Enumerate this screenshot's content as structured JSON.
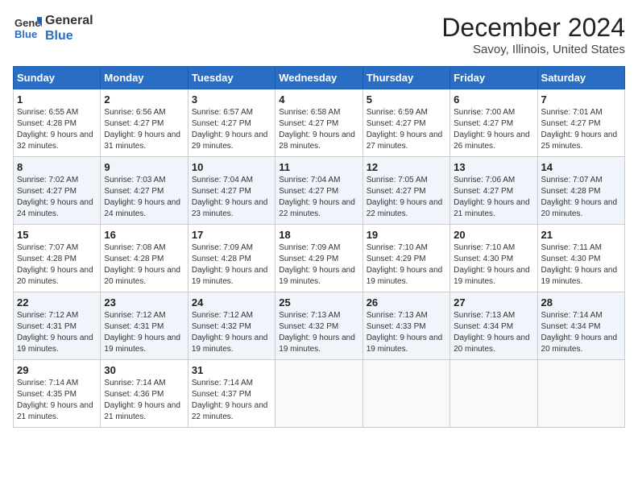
{
  "header": {
    "logo_general": "General",
    "logo_blue": "Blue",
    "month_title": "December 2024",
    "location": "Savoy, Illinois, United States"
  },
  "weekdays": [
    "Sunday",
    "Monday",
    "Tuesday",
    "Wednesday",
    "Thursday",
    "Friday",
    "Saturday"
  ],
  "weeks": [
    [
      {
        "day": "1",
        "sunrise": "6:55 AM",
        "sunset": "4:28 PM",
        "daylight": "9 hours and 32 minutes."
      },
      {
        "day": "2",
        "sunrise": "6:56 AM",
        "sunset": "4:27 PM",
        "daylight": "9 hours and 31 minutes."
      },
      {
        "day": "3",
        "sunrise": "6:57 AM",
        "sunset": "4:27 PM",
        "daylight": "9 hours and 29 minutes."
      },
      {
        "day": "4",
        "sunrise": "6:58 AM",
        "sunset": "4:27 PM",
        "daylight": "9 hours and 28 minutes."
      },
      {
        "day": "5",
        "sunrise": "6:59 AM",
        "sunset": "4:27 PM",
        "daylight": "9 hours and 27 minutes."
      },
      {
        "day": "6",
        "sunrise": "7:00 AM",
        "sunset": "4:27 PM",
        "daylight": "9 hours and 26 minutes."
      },
      {
        "day": "7",
        "sunrise": "7:01 AM",
        "sunset": "4:27 PM",
        "daylight": "9 hours and 25 minutes."
      }
    ],
    [
      {
        "day": "8",
        "sunrise": "7:02 AM",
        "sunset": "4:27 PM",
        "daylight": "9 hours and 24 minutes."
      },
      {
        "day": "9",
        "sunrise": "7:03 AM",
        "sunset": "4:27 PM",
        "daylight": "9 hours and 24 minutes."
      },
      {
        "day": "10",
        "sunrise": "7:04 AM",
        "sunset": "4:27 PM",
        "daylight": "9 hours and 23 minutes."
      },
      {
        "day": "11",
        "sunrise": "7:04 AM",
        "sunset": "4:27 PM",
        "daylight": "9 hours and 22 minutes."
      },
      {
        "day": "12",
        "sunrise": "7:05 AM",
        "sunset": "4:27 PM",
        "daylight": "9 hours and 22 minutes."
      },
      {
        "day": "13",
        "sunrise": "7:06 AM",
        "sunset": "4:27 PM",
        "daylight": "9 hours and 21 minutes."
      },
      {
        "day": "14",
        "sunrise": "7:07 AM",
        "sunset": "4:28 PM",
        "daylight": "9 hours and 20 minutes."
      }
    ],
    [
      {
        "day": "15",
        "sunrise": "7:07 AM",
        "sunset": "4:28 PM",
        "daylight": "9 hours and 20 minutes."
      },
      {
        "day": "16",
        "sunrise": "7:08 AM",
        "sunset": "4:28 PM",
        "daylight": "9 hours and 20 minutes."
      },
      {
        "day": "17",
        "sunrise": "7:09 AM",
        "sunset": "4:28 PM",
        "daylight": "9 hours and 19 minutes."
      },
      {
        "day": "18",
        "sunrise": "7:09 AM",
        "sunset": "4:29 PM",
        "daylight": "9 hours and 19 minutes."
      },
      {
        "day": "19",
        "sunrise": "7:10 AM",
        "sunset": "4:29 PM",
        "daylight": "9 hours and 19 minutes."
      },
      {
        "day": "20",
        "sunrise": "7:10 AM",
        "sunset": "4:30 PM",
        "daylight": "9 hours and 19 minutes."
      },
      {
        "day": "21",
        "sunrise": "7:11 AM",
        "sunset": "4:30 PM",
        "daylight": "9 hours and 19 minutes."
      }
    ],
    [
      {
        "day": "22",
        "sunrise": "7:12 AM",
        "sunset": "4:31 PM",
        "daylight": "9 hours and 19 minutes."
      },
      {
        "day": "23",
        "sunrise": "7:12 AM",
        "sunset": "4:31 PM",
        "daylight": "9 hours and 19 minutes."
      },
      {
        "day": "24",
        "sunrise": "7:12 AM",
        "sunset": "4:32 PM",
        "daylight": "9 hours and 19 minutes."
      },
      {
        "day": "25",
        "sunrise": "7:13 AM",
        "sunset": "4:32 PM",
        "daylight": "9 hours and 19 minutes."
      },
      {
        "day": "26",
        "sunrise": "7:13 AM",
        "sunset": "4:33 PM",
        "daylight": "9 hours and 19 minutes."
      },
      {
        "day": "27",
        "sunrise": "7:13 AM",
        "sunset": "4:34 PM",
        "daylight": "9 hours and 20 minutes."
      },
      {
        "day": "28",
        "sunrise": "7:14 AM",
        "sunset": "4:34 PM",
        "daylight": "9 hours and 20 minutes."
      }
    ],
    [
      {
        "day": "29",
        "sunrise": "7:14 AM",
        "sunset": "4:35 PM",
        "daylight": "9 hours and 21 minutes."
      },
      {
        "day": "30",
        "sunrise": "7:14 AM",
        "sunset": "4:36 PM",
        "daylight": "9 hours and 21 minutes."
      },
      {
        "day": "31",
        "sunrise": "7:14 AM",
        "sunset": "4:37 PM",
        "daylight": "9 hours and 22 minutes."
      },
      null,
      null,
      null,
      null
    ]
  ],
  "labels": {
    "sunrise": "Sunrise:",
    "sunset": "Sunset:",
    "daylight": "Daylight:"
  }
}
